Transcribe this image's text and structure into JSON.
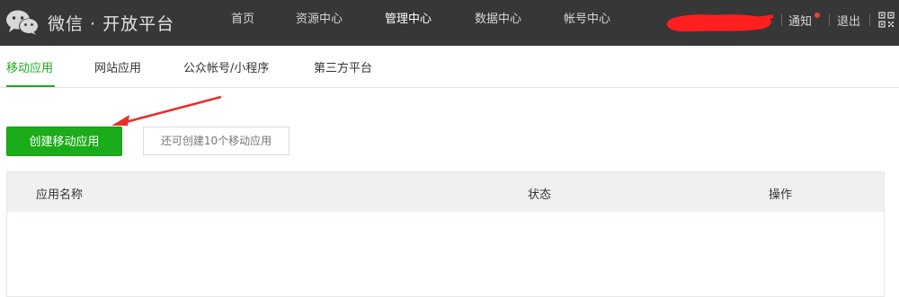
{
  "header": {
    "logo_text": "微信 · 开放平台",
    "nav": [
      {
        "label": "首页"
      },
      {
        "label": "资源中心"
      },
      {
        "label": "管理中心"
      },
      {
        "label": "数据中心"
      },
      {
        "label": "帐号中心"
      }
    ],
    "active_nav": "管理中心",
    "notify_label": "通知",
    "logout_label": "退出",
    "icons": {
      "logo": "wechat-logo-icon",
      "qr": "qrcode-icon"
    }
  },
  "subnav": {
    "tabs": [
      {
        "label": "移动应用"
      },
      {
        "label": "网站应用"
      },
      {
        "label": "公众帐号/小程序"
      },
      {
        "label": "第三方平台"
      }
    ],
    "active_tab": "移动应用"
  },
  "actions": {
    "create_label": "创建移动应用",
    "quota_tip": "还可创建10个移动应用"
  },
  "table": {
    "columns": [
      {
        "label": "应用名称"
      },
      {
        "label": "状态"
      },
      {
        "label": "操作"
      }
    ],
    "rows": []
  },
  "colors": {
    "topbar": "#373737",
    "accent": "#1aad19",
    "annotation": "#e8302a"
  }
}
